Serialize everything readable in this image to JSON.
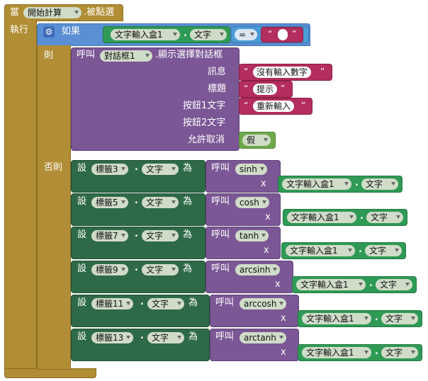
{
  "event": {
    "when_label": "當",
    "component": "開始計算",
    "suffix": ".被點選",
    "do_label": "執行"
  },
  "if_block": {
    "if_label": "如果",
    "textbox": "文字輸入盒1",
    "prop": "文字",
    "op": "=",
    "empty_text": ""
  },
  "then_label": "則",
  "else_label": "否則",
  "dialog": {
    "call_label": "呼叫",
    "component": "對話框1",
    "method": ".顯示選擇對話框",
    "message_label": "訊息",
    "message_value": "沒有輸入數字",
    "title_label": "標題",
    "title_value": "提示",
    "btn1_label": "按鈕1文字",
    "btn1_value": "重新輸入",
    "btn2_label": "按鈕2文字",
    "cancel_label": "允許取消",
    "cancel_value": "假"
  },
  "set_label": "設",
  "to_label": "為",
  "call_label": "呼叫",
  "x_label": "x",
  "quote": "“",
  "quote_close": "”",
  "dot": ".",
  "sets": [
    {
      "label": "標籤3",
      "prop": "文字",
      "fn": "sinh",
      "tb": "文字輸入盒1",
      "tbprop": "文字"
    },
    {
      "label": "標籤5",
      "prop": "文字",
      "fn": "cosh",
      "tb": "文字輸入盒1",
      "tbprop": "文字"
    },
    {
      "label": "標籤7",
      "prop": "文字",
      "fn": "tanh",
      "tb": "文字輸入盒1",
      "tbprop": "文字"
    },
    {
      "label": "標籤9",
      "prop": "文字",
      "fn": "arcsinh",
      "tb": "文字輸入盒1",
      "tbprop": "文字"
    },
    {
      "label": "標籤11",
      "prop": "文字",
      "fn": "arccosh",
      "tb": "文字輸入盒1",
      "tbprop": "文字"
    },
    {
      "label": "標籤13",
      "prop": "文字",
      "fn": "arctanh",
      "tb": "文字輸入盒1",
      "tbprop": "文字"
    }
  ]
}
